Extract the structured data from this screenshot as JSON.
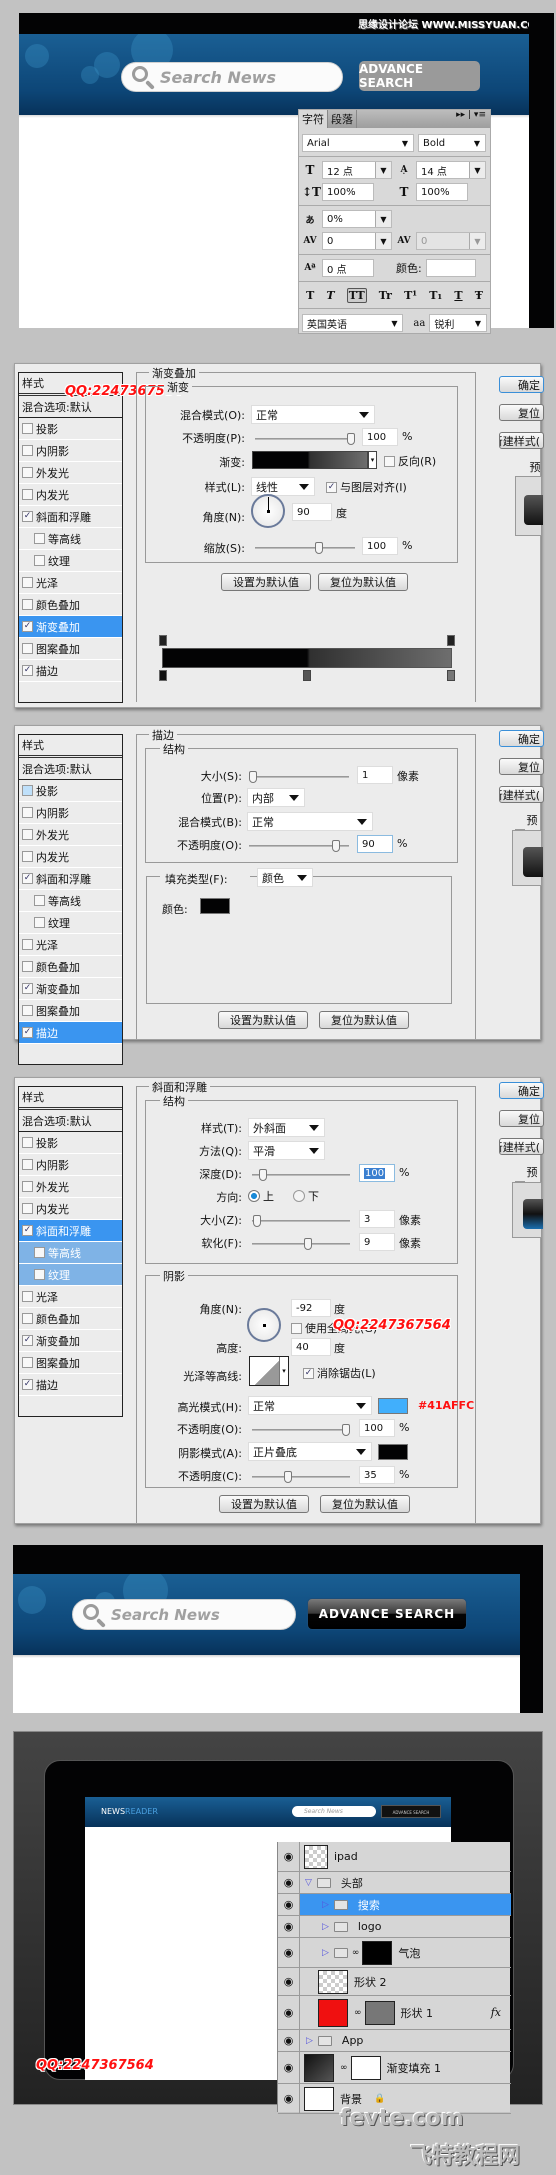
{
  "watermarks": {
    "top": "思缘设计论坛 WWW.MISSYUAN.COM",
    "qq": "QQ:2247367564",
    "site": "fevte.com",
    "site_cn": "飞特教程网"
  },
  "section1": {
    "search_placeholder": "Search News",
    "advance_button": "ADVANCE SEARCH"
  },
  "char_panel": {
    "tabs": [
      "字符",
      "段落"
    ],
    "font_family": "Arial",
    "font_style": "Bold",
    "font_size": "12 点",
    "leading": "14 点",
    "vertical_scale": "100%",
    "horizontal_scale": "100%",
    "tsume": "0%",
    "kerning": "0",
    "tracking": "0",
    "baseline_shift": "0 点",
    "color_label": "颜色:",
    "language": "英国英语",
    "antialias_icon": "aa",
    "antialias": "锐利",
    "style_buttons": [
      "T",
      "T",
      "TT",
      "Tr",
      "T¹",
      "T₁",
      "T",
      "Ŧ"
    ]
  },
  "style_list": {
    "header": "样式",
    "blend": "混合选项:默认",
    "items": [
      {
        "label": "投影",
        "indent": false
      },
      {
        "label": "内阴影",
        "indent": false
      },
      {
        "label": "外发光",
        "indent": false
      },
      {
        "label": "内发光",
        "indent": false
      },
      {
        "label": "斜面和浮雕",
        "indent": false
      },
      {
        "label": "等高线",
        "indent": true
      },
      {
        "label": "纹理",
        "indent": true
      },
      {
        "label": "光泽",
        "indent": false
      },
      {
        "label": "颜色叠加",
        "indent": false
      },
      {
        "label": "渐变叠加",
        "indent": false
      },
      {
        "label": "图案叠加",
        "indent": false
      },
      {
        "label": "描边",
        "indent": false
      }
    ],
    "checked": [
      false,
      false,
      false,
      false,
      true,
      false,
      false,
      false,
      false,
      true,
      false,
      true
    ]
  },
  "right_buttons": {
    "ok": "确定",
    "reset": "复位",
    "new_style": "新建样式(",
    "preview": "预览("
  },
  "common_buttons": {
    "set_default": "设置为默认值",
    "reset_default": "复位为默认值"
  },
  "gradient_overlay": {
    "title": "渐变叠加",
    "sub": "渐变",
    "blend_mode_label": "混合模式(O):",
    "blend_mode": "正常",
    "opacity_label": "不透明度(P):",
    "opacity": "100",
    "opacity_pct": 100,
    "gradient_label": "渐变:",
    "reverse_label": "反向(R)",
    "reverse": false,
    "style_label": "样式(L):",
    "style": "线性",
    "align_label": "与图层对齐(I)",
    "align": true,
    "angle_label": "角度(N):",
    "angle": "90",
    "deg": "度",
    "scale_label": "缩放(S):",
    "scale": "100",
    "scale_pct": 100,
    "percent": "%",
    "gradient_stops": [
      {
        "position": 0,
        "color": "#030304"
      },
      {
        "position": 50,
        "color": "#030304"
      },
      {
        "position": 100,
        "color": "#6e6e6e"
      }
    ]
  },
  "stroke": {
    "title": "描边",
    "structure": "结构",
    "size_label": "大小(S):",
    "size": "1",
    "px": "像素",
    "position_label": "位置(P):",
    "position": "内部",
    "blend_label": "混合模式(B):",
    "blend": "正常",
    "opacity_label": "不透明度(O):",
    "opacity": "90",
    "opacity_pct": 90,
    "percent": "%",
    "fill_type_label": "填充类型(F):",
    "fill_type": "颜色",
    "color_label": "颜色:",
    "color": "#030304"
  },
  "bevel": {
    "title": "斜面和浮雕",
    "structure": "结构",
    "style_label": "样式(T):",
    "style": "外斜面",
    "technique_label": "方法(Q):",
    "technique": "平滑",
    "depth_label": "深度(D):",
    "depth": "100",
    "depth_pct": 10,
    "percent": "%",
    "direction_label": "方向:",
    "dir_up": "上",
    "dir_down": "下",
    "size_label": "大小(Z):",
    "size": "3",
    "soften_label": "软化(F):",
    "soften": "9",
    "px": "像素",
    "shading": "阴影",
    "angle_label": "角度(N):",
    "angle": "-92",
    "deg": "度",
    "global_light_label": "使用全局光(G)",
    "global_light": false,
    "altitude_label": "高度:",
    "altitude": "40",
    "gloss_label": "光泽等高线:",
    "antialias_label": "消除锯齿(L)",
    "antialias": true,
    "highlight_label": "高光模式(H):",
    "highlight_mode": "正常",
    "highlight_color": "#41AFFC",
    "highlight_hex_note": "#41AFFC",
    "hl_opacity_label": "不透明度(O):",
    "hl_opacity": "100",
    "hl_opacity_pct": 100,
    "shadow_label": "阴影模式(A):",
    "shadow_mode": "正片叠底",
    "shadow_color": "#030304",
    "sh_opacity_label": "不透明度(C):",
    "sh_opacity": "35",
    "sh_opacity_pct": 35
  },
  "section5": {
    "search_placeholder": "Search News",
    "advance_button": "ADVANCE SEARCH"
  },
  "section6": {
    "logo_news": "NEWS",
    "logo_reader": "READER",
    "mini_search": "Search News",
    "mini_button": "ADVANCE SEARCH",
    "layers": [
      {
        "name": "ipad",
        "type": "smart"
      },
      {
        "name": "头部",
        "type": "group-open"
      },
      {
        "name": "搜索",
        "type": "group",
        "selected": true
      },
      {
        "name": "logo",
        "type": "group"
      },
      {
        "name": "气泡",
        "type": "group-mask"
      },
      {
        "name": "形状 2",
        "type": "layer"
      },
      {
        "name": "形状 1",
        "type": "shape-fx"
      },
      {
        "name": "App",
        "type": "group"
      },
      {
        "name": "渐变填充 1",
        "type": "fill"
      },
      {
        "name": "背景",
        "type": "background"
      }
    ],
    "fx": "fx"
  }
}
